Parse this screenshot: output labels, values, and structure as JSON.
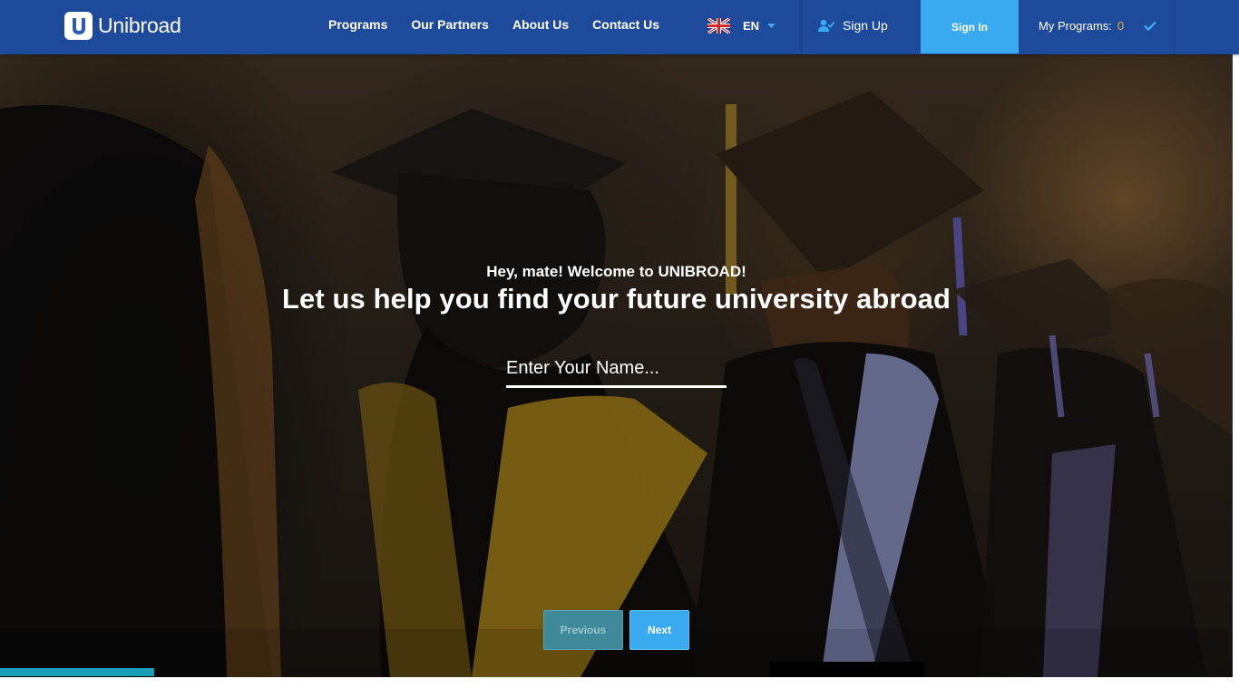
{
  "header": {
    "logo_text": "Unibroad",
    "logo_icon": "unibroad-u-logo",
    "nav": [
      "Programs",
      "Our Partners",
      "About Us",
      "Contact Us"
    ],
    "language": {
      "code": "EN",
      "flag_icon": "uk-flag-icon"
    },
    "signup_label": "Sign Up",
    "signin_label": "Sign In",
    "my_programs_label": "My Programs:",
    "my_programs_count": "0"
  },
  "hero": {
    "greeting": "Hey, mate! Welcome to UNIBROAD!",
    "headline": "Let us help you find your future university abroad",
    "name_placeholder": "Enter Your Name...",
    "prev_label": "Previous",
    "next_label": "Next",
    "background": "graduates-in-caps-and-gowns-photo"
  },
  "colors": {
    "header_bg": "#1d4a9a",
    "accent": "#3aaaf0",
    "count_color": "#f4b13a",
    "progress": "#1a9eb8"
  }
}
